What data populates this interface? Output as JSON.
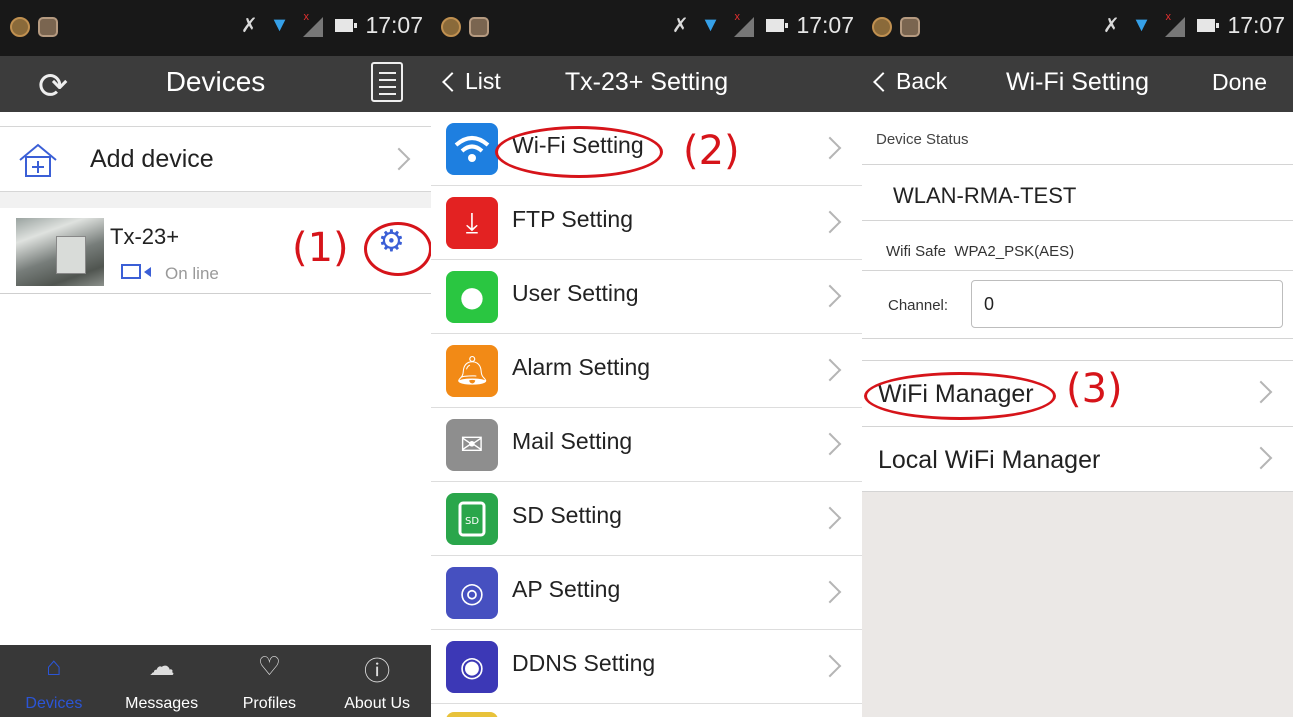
{
  "status_bar": {
    "time": "17:07"
  },
  "panel_devices": {
    "title": "Devices",
    "add_device": "Add device",
    "device": {
      "name": "Tx-23+",
      "status": "On line"
    },
    "annotation": "(1)",
    "tabs": [
      {
        "label": "Devices",
        "icon": "house-icon",
        "active": true
      },
      {
        "label": "Messages",
        "icon": "cloud-icon",
        "active": false
      },
      {
        "label": "Profiles",
        "icon": "heart-icon",
        "active": false
      },
      {
        "label": "About Us",
        "icon": "info-icon",
        "active": false
      }
    ]
  },
  "panel_settings": {
    "back": "List",
    "title": "Tx-23+ Setting",
    "annotation": "(2)",
    "items": [
      {
        "label": "Wi-Fi Setting",
        "icon": "wifi-icon",
        "color": "#1e7fe0"
      },
      {
        "label": "FTP Setting",
        "icon": "download-icon",
        "color": "#e32222"
      },
      {
        "label": "User Setting",
        "icon": "user-icon",
        "color": "#2ac641"
      },
      {
        "label": "Alarm Setting",
        "icon": "bell-icon",
        "color": "#f28a16"
      },
      {
        "label": "Mail Setting",
        "icon": "mail-icon",
        "color": "#8e8e8e"
      },
      {
        "label": "SD Setting",
        "icon": "sd-card-icon",
        "color": "#2aa64b"
      },
      {
        "label": "AP Setting",
        "icon": "ap-icon",
        "color": "#4650c0"
      },
      {
        "label": "DDNS Setting",
        "icon": "ddns-icon",
        "color": "#3c38b6"
      }
    ]
  },
  "panel_wifi": {
    "back": "Back",
    "title": "Wi-Fi Setting",
    "done": "Done",
    "section_header": "Device Status",
    "ssid": "WLAN-RMA-TEST",
    "wifi_safe_label": "Wifi Safe",
    "wifi_safe_value": "WPA2_PSK(AES)",
    "channel_label": "Channel:",
    "channel_value": "0",
    "wifi_manager": "WiFi Manager",
    "local_wifi_manager": "Local WiFi Manager",
    "annotation": "(3)"
  }
}
